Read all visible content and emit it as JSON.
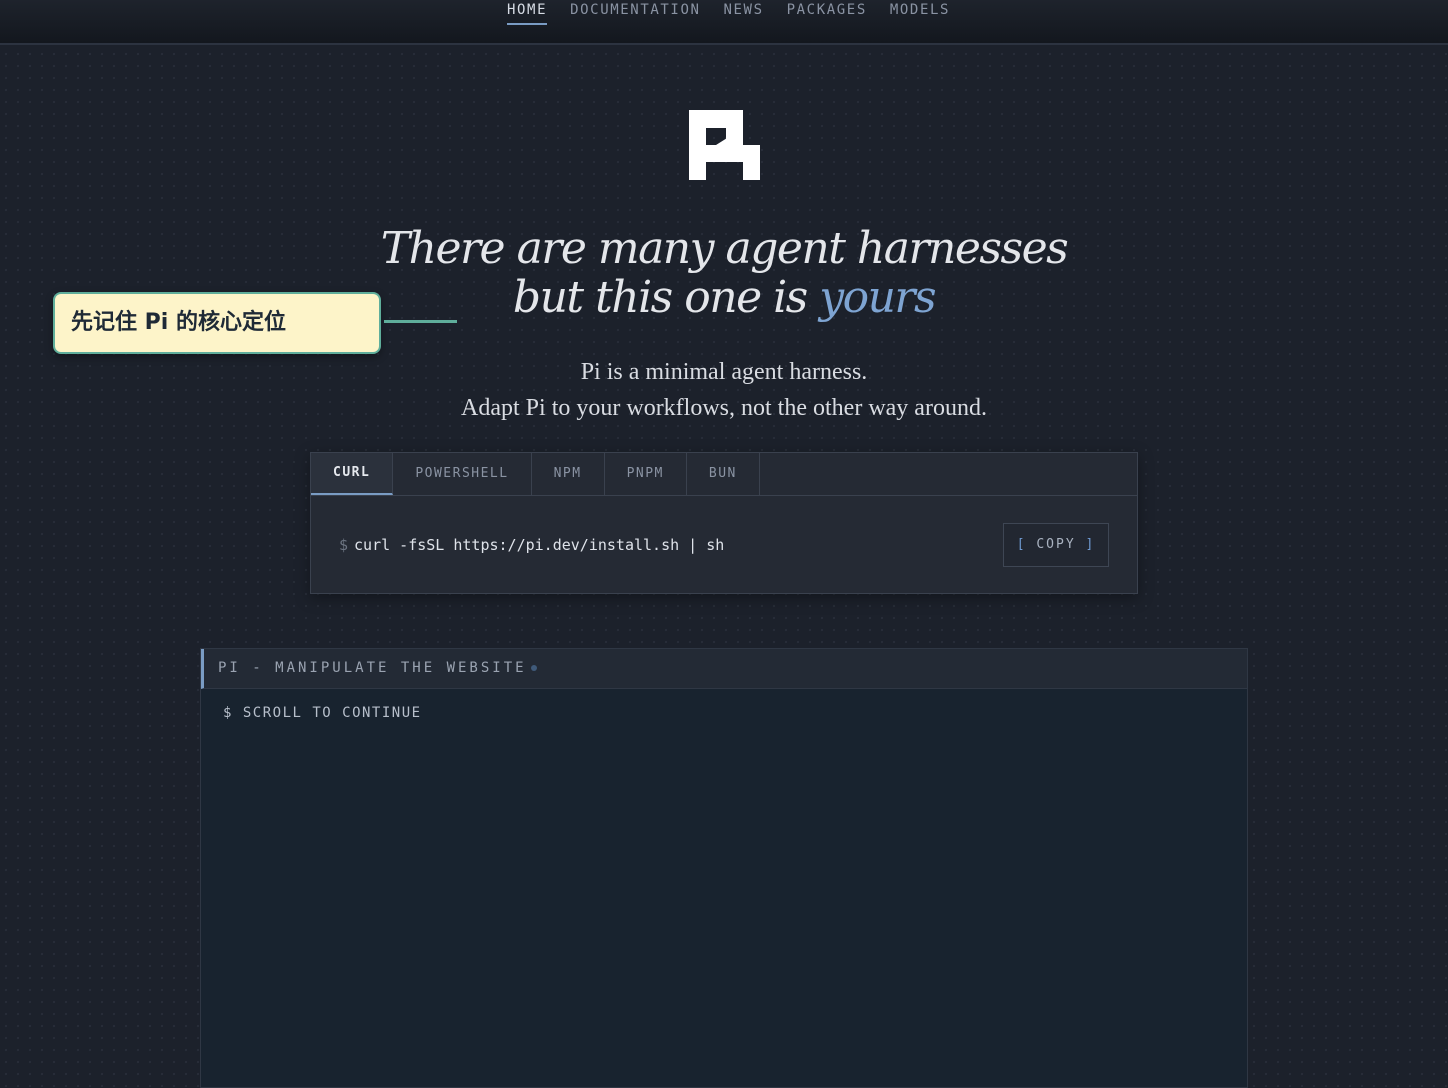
{
  "nav": {
    "items": [
      {
        "label": "HOME",
        "active": true
      },
      {
        "label": "DOCUMENTATION",
        "active": false
      },
      {
        "label": "NEWS",
        "active": false
      },
      {
        "label": "PACKAGES",
        "active": false
      },
      {
        "label": "MODELS",
        "active": false
      }
    ]
  },
  "hero": {
    "headline_line1": "There are many agent harnesses",
    "headline_line2_prefix": "but this one is ",
    "headline_line2_accent": "yours",
    "sub_line1": "Pi is a minimal agent harness.",
    "sub_line2": "Adapt Pi to your workflows, not the other way around."
  },
  "install": {
    "tabs": [
      "CURL",
      "POWERSHELL",
      "NPM",
      "PNPM",
      "BUN"
    ],
    "active_tab": "CURL",
    "prompt": "$",
    "command": "curl -fsSL https://pi.dev/install.sh | sh",
    "copy_open": "[",
    "copy_label": "COPY",
    "copy_close": "]"
  },
  "terminal": {
    "title": "PI - MANIPULATE THE WEBSITE",
    "line": "$ SCROLL TO CONTINUE"
  },
  "annotation": {
    "text": "先记住 Pi 的核心定位"
  },
  "colors": {
    "accent": "#7ea4d2",
    "callout_bg": "#fdf4c9",
    "callout_border": "#5fae9b"
  }
}
